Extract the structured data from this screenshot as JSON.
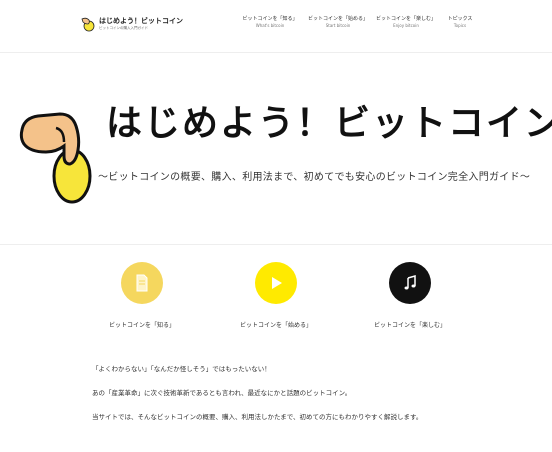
{
  "header": {
    "logo_title": "はじめよう！ビットコイン",
    "logo_subtitle": "ビットコインの購入入門ガイド",
    "nav": [
      {
        "jp": "ビットコインを「知る」",
        "en": "What's bitcoin"
      },
      {
        "jp": "ビットコインを「始める」",
        "en": "Start bitcoin"
      },
      {
        "jp": "ビットコインを「楽しむ」",
        "en": "Enjoy bitcoin"
      },
      {
        "jp": "トピックス",
        "en": "Topics"
      }
    ]
  },
  "hero": {
    "title": "はじめよう！ビットコイン",
    "subtitle": "〜ビットコインの概要、購入、利用法まで、初めてでも安心のビットコイン完全入門ガイド〜"
  },
  "features": [
    {
      "label": "ビットコインを「知る」",
      "icon": "document-icon",
      "color": "#F5D75E"
    },
    {
      "label": "ビットコインを「始める」",
      "icon": "play-icon",
      "color": "#FFEA00"
    },
    {
      "label": "ビットコインを「楽しむ」",
      "icon": "music-note-icon",
      "color": "#111111"
    }
  ],
  "intro": {
    "line1": "「よくわからない」「なんだか怪しそう」ではもったいない！",
    "line2": "あの「産業革命」に次ぐ技術革新であるとも言われ、最近なにかと話題のビットコイン。",
    "line3": "当サイトでは、そんなビットコインの概要、購入、利用法しかたまで、初めての方にもわかりやすく解説します。"
  },
  "colors": {
    "accent_yellow": "#FFEA00",
    "coin_yellow": "#F7E53A",
    "hand_skin": "#F4C28A"
  }
}
